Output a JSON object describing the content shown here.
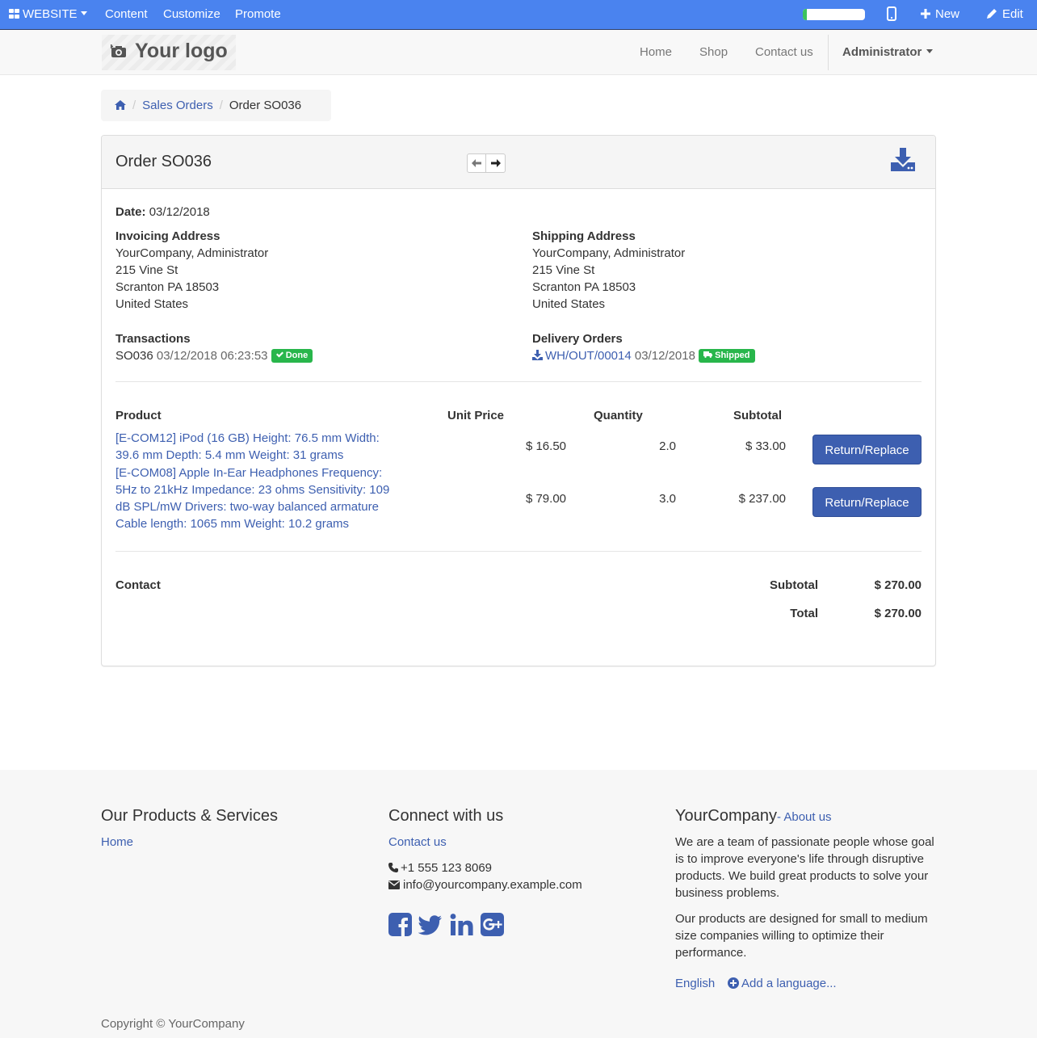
{
  "editbar": {
    "website_label": "WEBSITE",
    "menu": [
      "Content",
      "Customize",
      "Promote"
    ],
    "progress_fraction": 0.07,
    "new_label": "New",
    "edit_label": "Edit"
  },
  "header": {
    "logo_text": "Your logo",
    "nav": [
      "Home",
      "Shop",
      "Contact us"
    ],
    "user": "Administrator"
  },
  "breadcrumb": {
    "items": [
      "Sales Orders",
      "Order SO036"
    ]
  },
  "order": {
    "title": "Order SO036",
    "date_label": "Date:",
    "date_value": "03/12/2018",
    "invoicing": {
      "label": "Invoicing Address",
      "lines": [
        "YourCompany, Administrator",
        "215 Vine St",
        "Scranton PA 18503",
        "United States"
      ]
    },
    "shipping": {
      "label": "Shipping Address",
      "lines": [
        "YourCompany, Administrator",
        "215 Vine St",
        "Scranton PA 18503",
        "United States"
      ]
    },
    "transactions": {
      "label": "Transactions",
      "ref": "SO036",
      "datetime": "03/12/2018 06:23:53",
      "badge": "Done"
    },
    "delivery": {
      "label": "Delivery Orders",
      "ref": "WH/OUT/00014",
      "date": "03/12/2018",
      "badge": "Shipped"
    },
    "columns": [
      "Product",
      "Unit Price",
      "Quantity",
      "Subtotal"
    ],
    "lines": [
      {
        "product": "[E-COM12] iPod (16 GB) Height: 76.5 mm Width: 39.6 mm Depth: 5.4 mm Weight: 31 grams",
        "unit_price": "$ 16.50",
        "quantity": "2.0",
        "subtotal": "$ 33.00",
        "action": "Return/Replace"
      },
      {
        "product": "[E-COM08] Apple In-Ear Headphones Frequency: 5Hz to 21kHz Impedance: 23 ohms Sensitivity: 109 dB SPL/mW Drivers: two-way balanced armature Cable length: 1065 mm Weight: 10.2 grams",
        "unit_price": "$ 79.00",
        "quantity": "3.0",
        "subtotal": "$ 237.00",
        "action": "Return/Replace"
      }
    ],
    "contact_label": "Contact",
    "subtotal_label": "Subtotal",
    "subtotal_value": "$ 270.00",
    "total_label": "Total",
    "total_value": "$ 270.00"
  },
  "footer": {
    "products_heading": "Our Products & Services",
    "products_links": [
      "Home"
    ],
    "connect_heading": "Connect with us",
    "connect_link": "Contact us",
    "phone": "+1 555 123 8069",
    "email": "info@yourcompany.example.com",
    "company_heading": "YourCompany",
    "about_link": "- About us",
    "about_p1": "We are a team of passionate people whose goal is to improve everyone's life through disruptive products. We build great products to solve your business problems.",
    "about_p2": "Our products are designed for small to medium size companies willing to optimize their performance.",
    "language": "English",
    "add_language": "Add a language...",
    "copyright": "Copyright © YourCompany"
  },
  "colors": {
    "editbar": "#4a83ef",
    "link": "#3d5fb0",
    "badge_green": "#28b64b"
  }
}
